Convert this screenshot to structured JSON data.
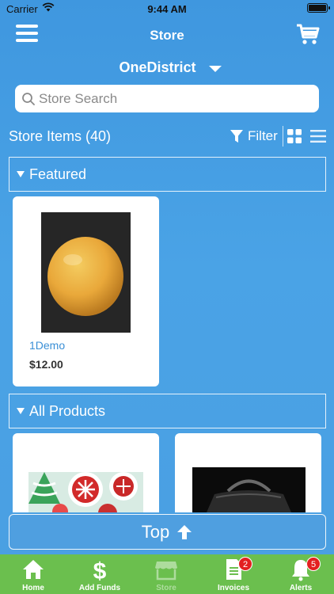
{
  "status_bar": {
    "carrier": "Carrier",
    "time": "9:44 AM"
  },
  "nav": {
    "title": "Store",
    "menu_icon": "hamburger-icon",
    "cart_icon": "cart-icon"
  },
  "district": {
    "name": "OneDistrict"
  },
  "search": {
    "placeholder": "Store Search",
    "value": ""
  },
  "items_bar": {
    "count_label": "Store Items (40)",
    "filter_label": "Filter",
    "view_mode": "grid"
  },
  "sections": {
    "featured": {
      "label": "Featured"
    },
    "all_products": {
      "label": "All Products"
    }
  },
  "featured_items": [
    {
      "name": "1Demo",
      "price": "$12.00",
      "image": "grapefruit"
    }
  ],
  "all_products_items": [
    {
      "name": "",
      "price": "",
      "image": "christmas-cookies"
    },
    {
      "name": "",
      "price": "",
      "image": "black-duffel-bag"
    }
  ],
  "top_button": {
    "label": "Top"
  },
  "tabbar": {
    "items": [
      {
        "label": "Home",
        "icon": "home-icon",
        "active": true
      },
      {
        "label": "Add Funds",
        "icon": "dollar-icon",
        "active": true
      },
      {
        "label": "Store",
        "icon": "store-icon",
        "active": false
      },
      {
        "label": "Invoices",
        "icon": "invoice-icon",
        "active": true,
        "badge": "2"
      },
      {
        "label": "Alerts",
        "icon": "bell-icon",
        "active": true,
        "badge": "5"
      }
    ]
  },
  "colors": {
    "background": "#4aa3e6",
    "tabbar": "#6bbf4e",
    "link": "#3a8fd6",
    "badge": "#e32020"
  }
}
